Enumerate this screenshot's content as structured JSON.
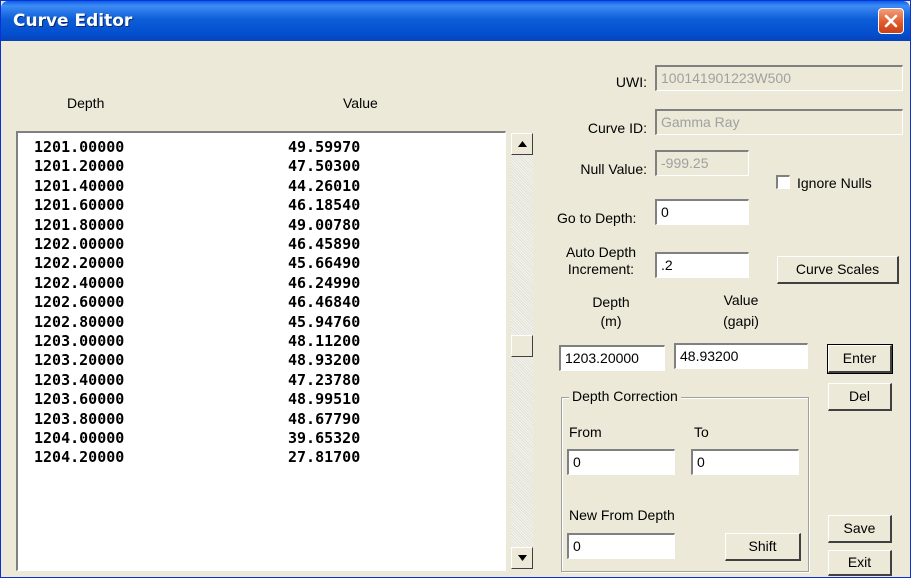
{
  "window": {
    "title": "Curve Editor"
  },
  "list": {
    "headers": {
      "depth": "Depth",
      "value": "Value"
    },
    "rows": [
      {
        "depth": "1201.00000",
        "value": "49.59970"
      },
      {
        "depth": "1201.20000",
        "value": "47.50300"
      },
      {
        "depth": "1201.40000",
        "value": "44.26010"
      },
      {
        "depth": "1201.60000",
        "value": "46.18540"
      },
      {
        "depth": "1201.80000",
        "value": "49.00780"
      },
      {
        "depth": "1202.00000",
        "value": "46.45890"
      },
      {
        "depth": "1202.20000",
        "value": "45.66490"
      },
      {
        "depth": "1202.40000",
        "value": "46.24990"
      },
      {
        "depth": "1202.60000",
        "value": "46.46840"
      },
      {
        "depth": "1202.80000",
        "value": "45.94760"
      },
      {
        "depth": "1203.00000",
        "value": "48.11200"
      },
      {
        "depth": "1203.20000",
        "value": "48.93200"
      },
      {
        "depth": "1203.40000",
        "value": "47.23780"
      },
      {
        "depth": "1203.60000",
        "value": "48.99510"
      },
      {
        "depth": "1203.80000",
        "value": "48.67790"
      },
      {
        "depth": "1204.00000",
        "value": "39.65320"
      },
      {
        "depth": "1204.20000",
        "value": "27.81700"
      }
    ]
  },
  "form": {
    "uwi_label": "UWI:",
    "uwi_value": "100141901223W500",
    "curve_id_label": "Curve ID:",
    "curve_id_value": "Gamma Ray",
    "null_value_label": "Null Value:",
    "null_value": "-999.25",
    "ignore_nulls_label": "Ignore Nulls",
    "ignore_nulls_checked": false,
    "goto_depth_label": "Go to Depth:",
    "goto_depth_value": "0",
    "auto_increment_label_1": "Auto Depth",
    "auto_increment_label_2": "Increment:",
    "auto_increment_value": ".2",
    "curve_scales_button": "Curve Scales",
    "depth_col_label": "Depth",
    "depth_col_unit": "(m)",
    "value_col_label": "Value",
    "value_col_unit": "(gapi)",
    "depth_value": "1203.20000",
    "value_value": "48.93200",
    "enter_button": "Enter",
    "del_button": "Del"
  },
  "depth_correction": {
    "title": "Depth Correction",
    "from_label": "From",
    "to_label": "To",
    "from_value": "0",
    "to_value": "0",
    "new_from_label": "New From Depth",
    "new_from_value": "0",
    "shift_button": "Shift"
  },
  "actions": {
    "save_button": "Save",
    "exit_button": "Exit"
  },
  "colors": {
    "title_bar": "#0450d0",
    "face": "#ece9d8",
    "close": "#e05a2a"
  }
}
